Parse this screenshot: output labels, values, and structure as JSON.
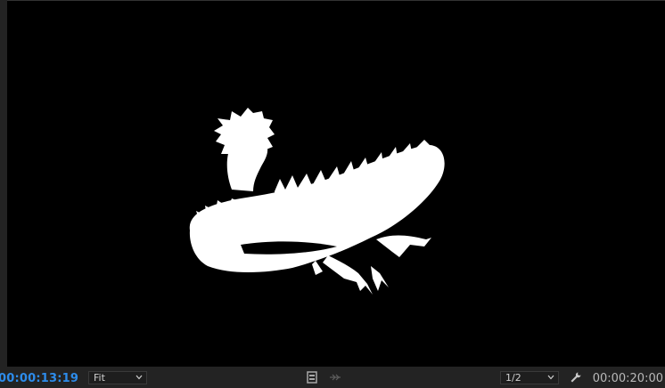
{
  "monitor": {
    "current_timecode": "00:00:13:19",
    "duration_timecode": "00:00:20:00",
    "zoom_select": {
      "value": "Fit"
    },
    "resolution_select": {
      "value": "1/2"
    }
  },
  "icons": {
    "export_frame": "film-frame-icon",
    "insert": "insert-icon",
    "settings": "wrench-icon",
    "dropdown": "chevron-down-icon"
  },
  "colors": {
    "timecode_accent": "#2d8ceb",
    "panel_bg": "#232323",
    "frame_bg": "#000000"
  }
}
